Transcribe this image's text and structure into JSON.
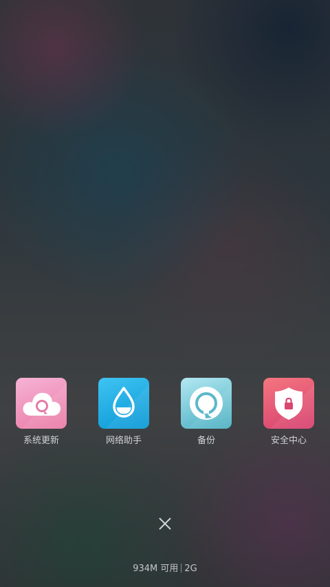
{
  "apps": [
    {
      "label": "系统更新",
      "icon": "cloud-refresh-icon",
      "colors": [
        "#f5a9cf",
        "#e9799f"
      ]
    },
    {
      "label": "网络助手",
      "icon": "water-drop-icon",
      "colors": [
        "#42c2f0",
        "#0d9bd8"
      ]
    },
    {
      "label": "备份",
      "icon": "backup-refresh-icon",
      "colors": [
        "#a6e3ef",
        "#4fb3c4"
      ]
    },
    {
      "label": "安全中心",
      "icon": "shield-lock-icon",
      "colors": [
        "#f3717e",
        "#d94473"
      ]
    }
  ],
  "close_icon": "close-icon",
  "status": {
    "memory": "934M 可用",
    "network": "2G"
  }
}
